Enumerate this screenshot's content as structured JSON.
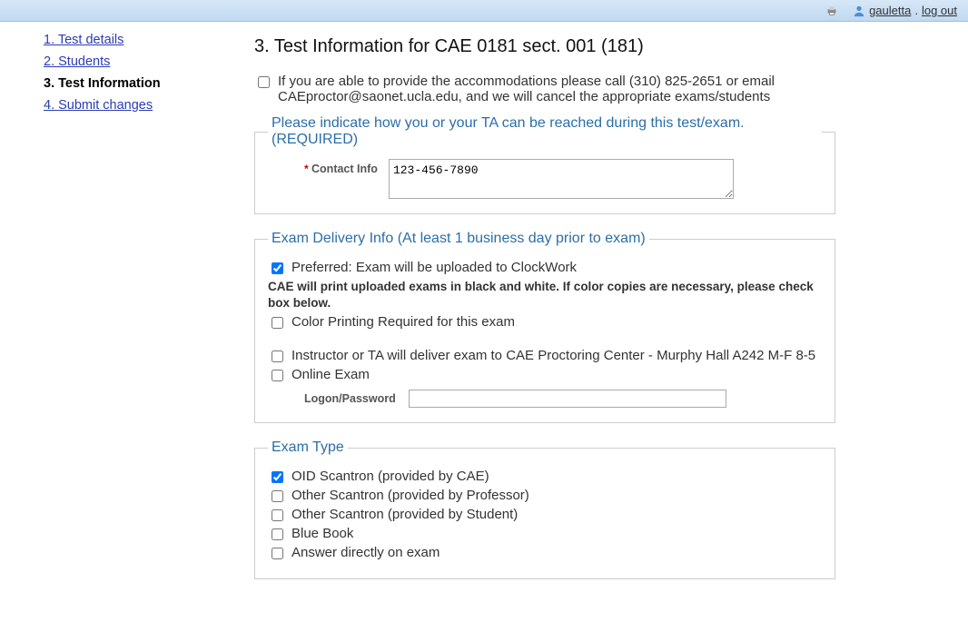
{
  "topbar": {
    "username": "gauletta",
    "separator": ".",
    "logout": "log out"
  },
  "sidebar": {
    "items": [
      {
        "label": "1. Test details",
        "current": false
      },
      {
        "label": "2. Students",
        "current": false
      },
      {
        "label": "3. Test Information",
        "current": true
      },
      {
        "label": "4. Submit changes",
        "current": false
      }
    ]
  },
  "page_title": "3. Test Information for CAE 0181 sect. 001 (181)",
  "accommodation_notice": "If you are able to provide the accommodations please call (310) 825-2651 or email CAEproctor@saonet.ucla.edu, and we will cancel the appropriate exams/students",
  "accommodation_checked": false,
  "contact_section": {
    "legend": "Please indicate how you or your TA can be reached during this test/exam. (REQUIRED)",
    "label": "Contact Info",
    "value": "123-456-7890"
  },
  "delivery_section": {
    "legend": "Exam Delivery Info (At least 1 business day prior to exam)",
    "preferred": {
      "checked": true,
      "label": "Preferred: Exam will be uploaded to ClockWork"
    },
    "print_note": "CAE will print uploaded exams in black and white. If color copies are necessary, please check box below.",
    "color": {
      "checked": false,
      "label": "Color Printing Required for this exam"
    },
    "deliver": {
      "checked": false,
      "label": "Instructor or TA will deliver exam to CAE Proctoring Center - Murphy Hall A242 M-F 8-5"
    },
    "online": {
      "checked": false,
      "label": "Online Exam"
    },
    "logon_label": "Logon/Password",
    "logon_value": ""
  },
  "exam_type_section": {
    "legend": "Exam Type",
    "options": [
      {
        "checked": true,
        "label": "OID Scantron (provided by CAE)"
      },
      {
        "checked": false,
        "label": "Other Scantron (provided by Professor)"
      },
      {
        "checked": false,
        "label": "Other Scantron (provided by Student)"
      },
      {
        "checked": false,
        "label": "Blue Book"
      },
      {
        "checked": false,
        "label": "Answer directly on exam"
      }
    ]
  }
}
